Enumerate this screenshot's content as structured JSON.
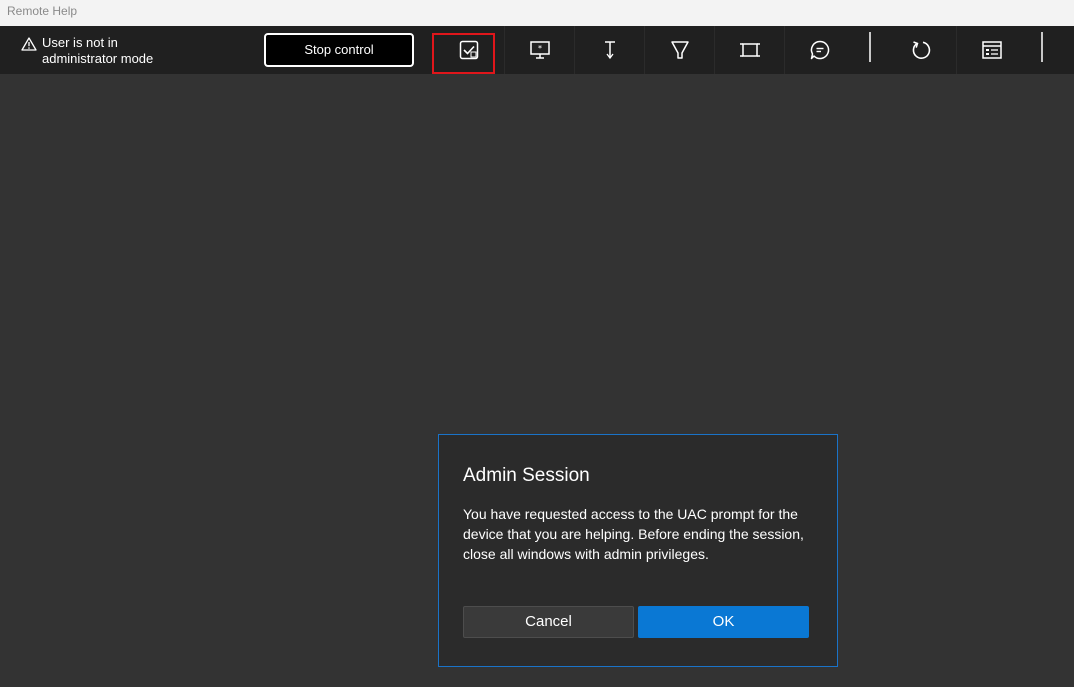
{
  "window": {
    "title": "Remote Help"
  },
  "toolbar": {
    "status": {
      "icon": "warning-icon",
      "line1": "User is not in",
      "line2": "administrator mode"
    },
    "stop_label": "Stop control",
    "tools": [
      {
        "name": "admin-session-icon"
      },
      {
        "name": "monitor-icon"
      },
      {
        "name": "laser-pointer-icon"
      },
      {
        "name": "highlighter-icon"
      },
      {
        "name": "screen-crop-icon"
      },
      {
        "name": "chat-icon"
      },
      {
        "name": "refresh-icon"
      },
      {
        "name": "task-manager-icon"
      }
    ],
    "highlight_color": "#e0161b"
  },
  "dialog": {
    "title": "Admin Session",
    "body": "You have requested access to the UAC prompt for the device that you are helping. Before ending the session, close all windows with admin privileges.",
    "cancel_label": "Cancel",
    "ok_label": "OK",
    "accent": "#0a78d4"
  }
}
